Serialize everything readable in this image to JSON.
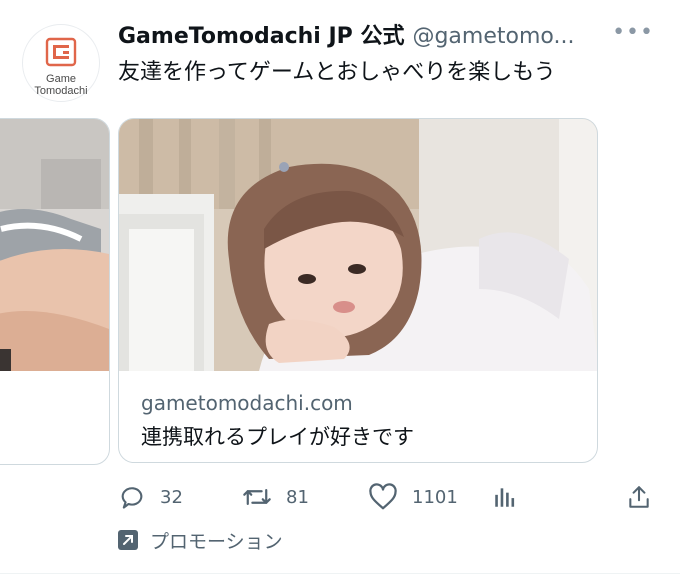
{
  "account": {
    "display_name": "GameTomodachi JP 公式",
    "handle": "@gametomo...",
    "avatar_brand_line1": "Game",
    "avatar_brand_line2": "Tomodachi"
  },
  "tweet": {
    "text": "友達を作ってゲームとおしゃべりを楽しもう"
  },
  "card": {
    "domain": "gametomodachi.com",
    "title": "連携取れるプレイが好きです"
  },
  "actions": {
    "replies": "32",
    "retweets": "81",
    "likes": "1101"
  },
  "promo": {
    "label": "プロモーション"
  },
  "colors": {
    "text": "#0f1419",
    "secondary": "#536471",
    "border": "#cfd9de",
    "logo_accent": "#e0664a"
  }
}
